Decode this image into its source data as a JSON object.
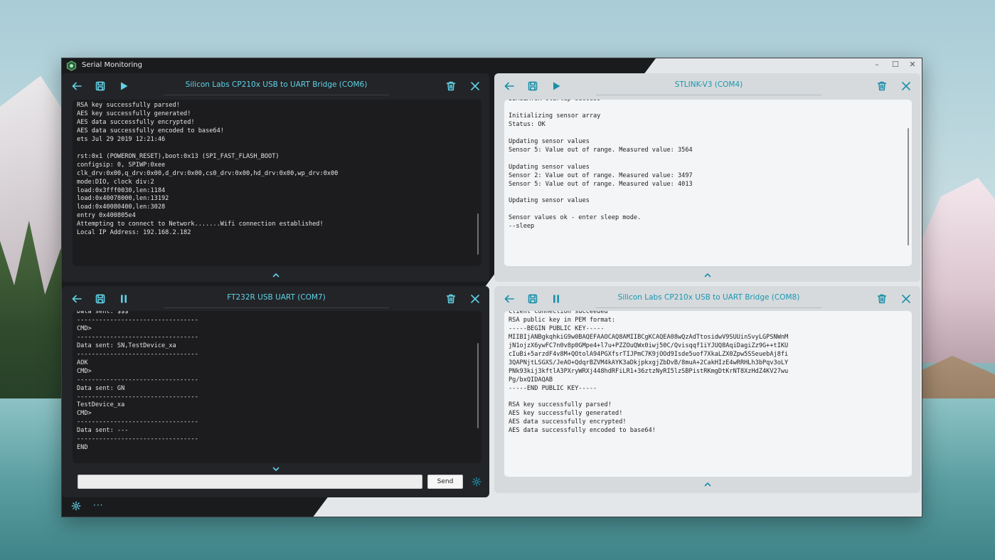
{
  "app": {
    "title": "Serial Monitoring"
  },
  "window_controls": {
    "minimize": "–",
    "maximize": "☐",
    "close": "✕"
  },
  "panels": {
    "top_left": {
      "title": "Silicon Labs CP210x USB to UART Bridge (COM6)",
      "state": "paused",
      "console": "RSA key successfully parsed!\nAES key successfully generated!\nAES data successfully encrypted!\nAES data successfully encoded to base64!\nets Jul 29 2019 12:21:46\n\nrst:0x1 (POWERON_RESET),boot:0x13 (SPI_FAST_FLASH_BOOT)\nconfigsip: 0, SPIWP:0xee\nclk_drv:0x00,q_drv:0x00,d_drv:0x00,cs0_drv:0x00,hd_drv:0x00,wp_drv:0x00\nmode:DIO, clock div:2\nload:0x3fff0030,len:1184\nload:0x40078000,len:13192\nload:0x40080400,len:3028\nentry 0x400805e4\nAttempting to connect to Network.......Wifi connection established!\nLocal IP Address: 192.168.2.182"
    },
    "top_right": {
      "title": "STLINK-V3 (COM4)",
      "state": "paused",
      "console": "SIMULATOR startup success\n\nInitializing sensor array\nStatus: OK\n\nUpdating sensor values\nSensor 5: Value out of range. Measured value: 3564\n\nUpdating sensor values\nSensor 2: Value out of range. Measured value: 3497\nSensor 5: Value out of range. Measured value: 4013\n\nUpdating sensor values\n\nSensor values ok - enter sleep mode.\n--sleep"
    },
    "bottom_left": {
      "title": "FT232R USB UART (COM7)",
      "state": "running",
      "console": "Data sent: $$$\n---------------------------------\nCMD>\n---------------------------------\nData sent: SN,TestDevice_xa\n---------------------------------\nAOK\nCMD>\n---------------------------------\nData sent: GN\n---------------------------------\nTestDevice_xa\nCMD>\n---------------------------------\nData sent: ---\n---------------------------------\nEND",
      "send_value": "",
      "send_label": "Send"
    },
    "bottom_right": {
      "title": "Silicon Labs CP210x USB to UART Bridge (COM8)",
      "state": "running",
      "console": "Client connection succeeded\nRSA public key in PEM format:\n-----BEGIN PUBLIC KEY-----\nMIIBIjANBgkqhkiG9w0BAQEFAAOCAQ8AMIIBCgKCAQEA08wQzAdTtosidwV9SUUinSvyLGPSNWnM\njN1ojzX6ywFC7n0v8p0GMpe4+l7u+PZZOuQWx0iwj50C/Qvisqqf1iYJUQ8AqiDagiZz9G++tIKU\ncIuBi+5arzdF4v8M+QOtolA94PGXfsrTIJPmC7K9jOOd9Isde5uof7XkaLZX0Zpw5SSeuebAj8fi\n3QAPNjtLSGXS/JeAO+QdqrBZVM4kAYK3aDkjpkxgjZbDvB/8muA+2CakHIzE4wRRHLh3bPqv3oLY\nPNk93kij3kftlA3PXryWRXj448hdRFiLR1+36ztzNyRI5lzSBPistRKmgDtKrNT8XzHdZ4KV27wu\nPg/bxQIDAQAB\n-----END PUBLIC KEY-----\n\nRSA key successfully parsed!\nAES key successfully generated!\nAES data successfully encrypted!\nAES data successfully encoded to base64!"
    }
  },
  "colors": {
    "accent_dark": "#5fd3e8",
    "accent_light": "#1a8fa8"
  },
  "icons": [
    "app-logo-icon",
    "back-arrow-icon",
    "save-icon",
    "play-icon",
    "pause-icon",
    "trash-icon",
    "close-icon",
    "chevron-up-icon",
    "chevron-down-icon",
    "gear-icon",
    "more-icon"
  ]
}
